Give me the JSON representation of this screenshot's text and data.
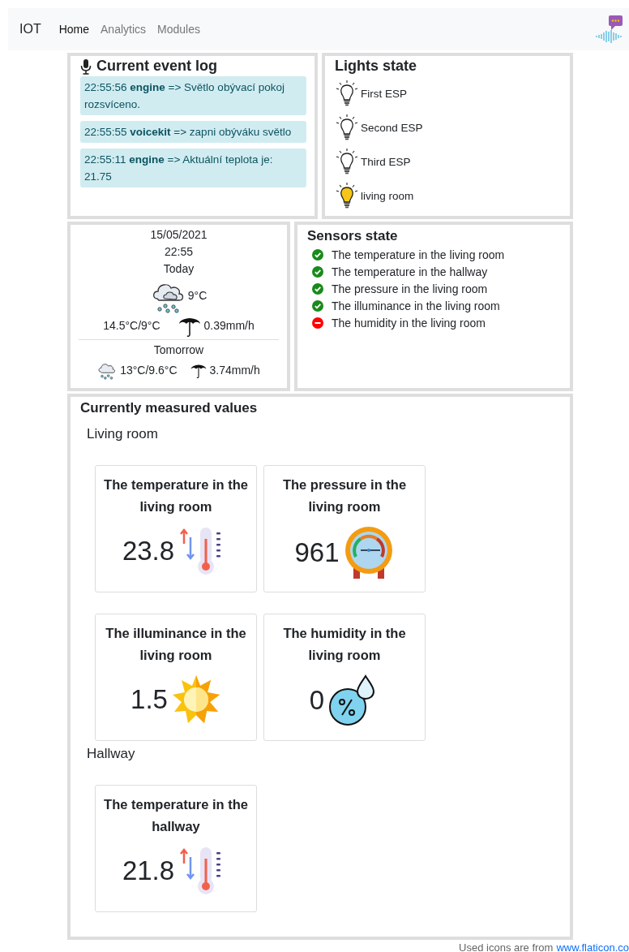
{
  "navbar": {
    "brand": "IOT",
    "links": [
      {
        "label": "Home",
        "selected": true
      },
      {
        "label": "Analytics",
        "selected": false
      },
      {
        "label": "Modules",
        "selected": false
      }
    ]
  },
  "event_log": {
    "title": "Current event log",
    "entries": [
      {
        "time": "22:55:56",
        "source": "engine",
        "message": "=> Světlo obývací pokoj rozsvíceno."
      },
      {
        "time": "22:55:55",
        "source": "voicekit",
        "message": "=> zapni obýváku světlo"
      },
      {
        "time": "22:55:11",
        "source": "engine",
        "message": "=> Aktuální teplota je: 21.75"
      }
    ]
  },
  "lights": {
    "title": "Lights state",
    "items": [
      {
        "name": "First ESP",
        "on": false
      },
      {
        "name": "Second ESP",
        "on": false
      },
      {
        "name": "Third ESP",
        "on": false
      },
      {
        "name": "living room",
        "on": true
      }
    ]
  },
  "weather": {
    "date": "15/05/2021",
    "time": "22:55",
    "today": {
      "label": "Today",
      "temperature": "9°C",
      "range": "14.5°C/9°C",
      "rain": "0.39mm/h"
    },
    "tomorrow": {
      "label": "Tomorrow",
      "range": "13°C/9.6°C",
      "rain": "3.74mm/h"
    }
  },
  "sensors": {
    "title": "Sensors state",
    "items": [
      {
        "name": "The temperature in the living room",
        "ok": true
      },
      {
        "name": "The temperature in the hallway",
        "ok": true
      },
      {
        "name": "The pressure in the living room",
        "ok": true
      },
      {
        "name": "The illuminance in the living room",
        "ok": true
      },
      {
        "name": "The humidity in the living room",
        "ok": false
      }
    ]
  },
  "measured": {
    "title": "Currently measured values",
    "rooms": [
      {
        "name": "Living room",
        "cards": [
          {
            "title": "The temperature in the living room",
            "value": "23.8",
            "kind": "temperature"
          },
          {
            "title": "The pressure in the living room",
            "value": "961",
            "kind": "pressure"
          },
          {
            "title": "The illuminance in the living room",
            "value": "1.5",
            "kind": "illuminance"
          },
          {
            "title": "The humidity in the living room",
            "value": "0",
            "kind": "humidity"
          }
        ]
      },
      {
        "name": "Hallway",
        "cards": [
          {
            "title": "The temperature in the hallway",
            "value": "21.8",
            "kind": "temperature"
          }
        ]
      }
    ]
  },
  "footer": {
    "text": "Used icons are from",
    "link": "www.flaticon.co"
  }
}
